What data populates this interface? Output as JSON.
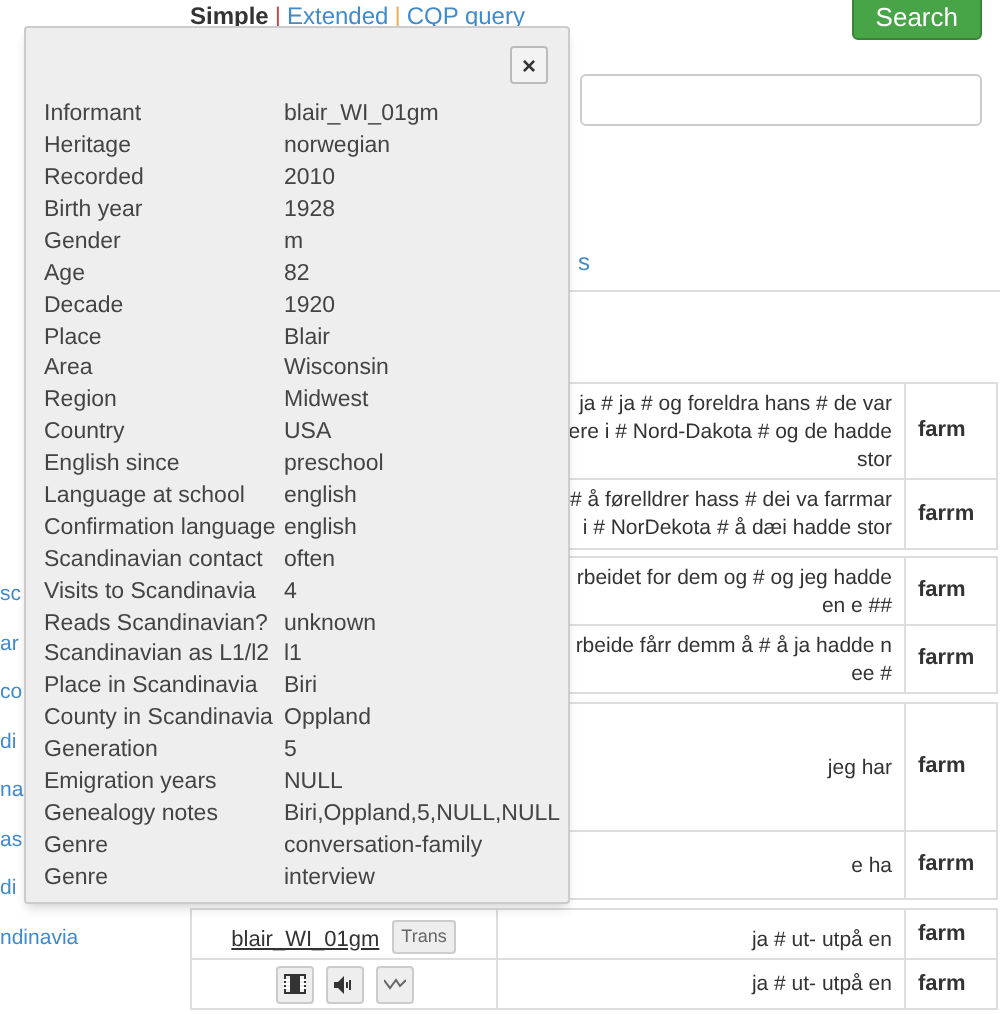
{
  "query_tabs": [
    {
      "label": "Simple",
      "selected": true
    },
    {
      "label": "Extended",
      "selected": false
    },
    {
      "label": "CQP query",
      "selected": false
    }
  ],
  "tab_separators": [
    "|",
    "|"
  ],
  "search_button": "Search",
  "link_fragment": "s",
  "sidebar_fragments": [
    "sc",
    "ar",
    "co",
    "di",
    "na",
    "as",
    "di",
    "ndinavia"
  ],
  "results": [
    {
      "rows": [
        {
          "text": "ja # ja # og foreldra hans # de var\nere i # Nord-Dakota # og de hadde\nstor",
          "word": "farm"
        },
        {
          "text": "# å førelldrer hass # dei va farrmar\ni # NorDekota # å dæi hadde stor",
          "word": "farrm"
        }
      ]
    },
    {
      "rows": [
        {
          "text": "rbeidet for dem og # og jeg hadde\nen e ##",
          "word": "farm"
        },
        {
          "text": "rbeide fårr demm å # å ja hadde n\nee #",
          "word": "farrm"
        }
      ]
    },
    {
      "rows": [
        {
          "text": "jeg har",
          "word": "farm"
        },
        {
          "text": "e ha",
          "word": "farrm"
        }
      ]
    },
    {
      "rows": [
        {
          "kind": "speaker",
          "speaker": "blair_WI_01gm",
          "trans": "Trans",
          "text": "ja # ut- utpå en",
          "word": "farm"
        },
        {
          "kind": "media",
          "text": "ja # ut- utpå en",
          "word": "farm"
        }
      ]
    }
  ],
  "popup": {
    "close": "×",
    "fields": [
      {
        "label": "Informant",
        "value": "blair_WI_01gm"
      },
      {
        "label": "Heritage",
        "value": "norwegian"
      },
      {
        "label": "Recorded",
        "value": "2010"
      },
      {
        "label": "Birth year",
        "value": "1928"
      },
      {
        "label": "Gender",
        "value": "m"
      },
      {
        "label": "Age",
        "value": "82"
      },
      {
        "label": "Decade",
        "value": "1920"
      },
      {
        "label": "Place",
        "value": "Blair"
      },
      {
        "label": "Area",
        "value": "Wisconsin"
      },
      {
        "label": "Region",
        "value": "Midwest"
      },
      {
        "label": "Country",
        "value": "USA"
      },
      {
        "label": "English since",
        "value": "preschool"
      },
      {
        "label": "Language at school",
        "value": "english"
      },
      {
        "label": "Confirmation language",
        "value": "english"
      },
      {
        "label": "Scandinavian contact",
        "value": "often"
      },
      {
        "label": "Visits to Scandinavia",
        "value": "4"
      },
      {
        "label": "Reads Scandinavian?",
        "value": "unknown"
      },
      {
        "label": "Scandinavian as L1/l2",
        "value": "l1"
      },
      {
        "label": "Place in Scandinavia",
        "value": "Biri"
      },
      {
        "label": "County in Scandinavia",
        "value": "Oppland"
      },
      {
        "label": "Generation",
        "value": "5"
      },
      {
        "label": "Emigration years",
        "value": "NULL"
      },
      {
        "label": "Genealogy notes",
        "value": "Biri,Oppland,5,NULL,NULL"
      },
      {
        "label": "Genre",
        "value": "conversation-family"
      },
      {
        "label": "Genre",
        "value": "interview"
      }
    ]
  }
}
